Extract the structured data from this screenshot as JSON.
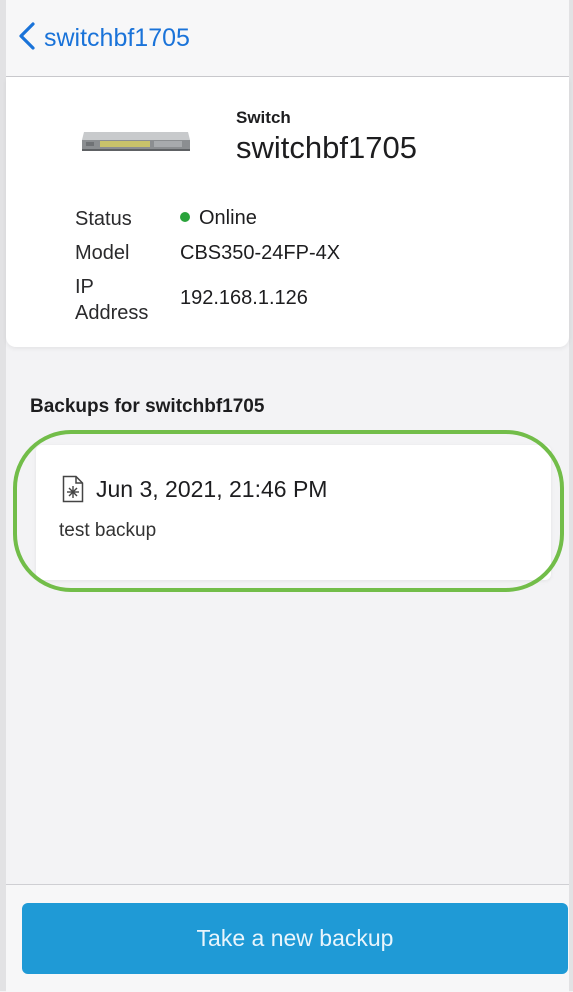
{
  "navbar": {
    "back_label": "switchbf1705"
  },
  "device": {
    "type_label": "Switch",
    "name": "switchbf1705",
    "status_label": "Status",
    "status_value": "Online",
    "status_color": "#2aa33b",
    "model_label": "Model",
    "model_value": "CBS350-24FP-4X",
    "ip_label_line1": "IP",
    "ip_label_line2": "Address",
    "ip_value": "192.168.1.126"
  },
  "backups": {
    "section_title": "Backups for switchbf1705",
    "items": [
      {
        "date": "Jun 3, 2021, 21:46 PM",
        "description": "test backup",
        "icon": "config-file-icon"
      }
    ]
  },
  "actions": {
    "new_backup_label": "Take a new backup",
    "accent": "#1f9ad6"
  },
  "highlight": {
    "color": "#72bd49"
  }
}
